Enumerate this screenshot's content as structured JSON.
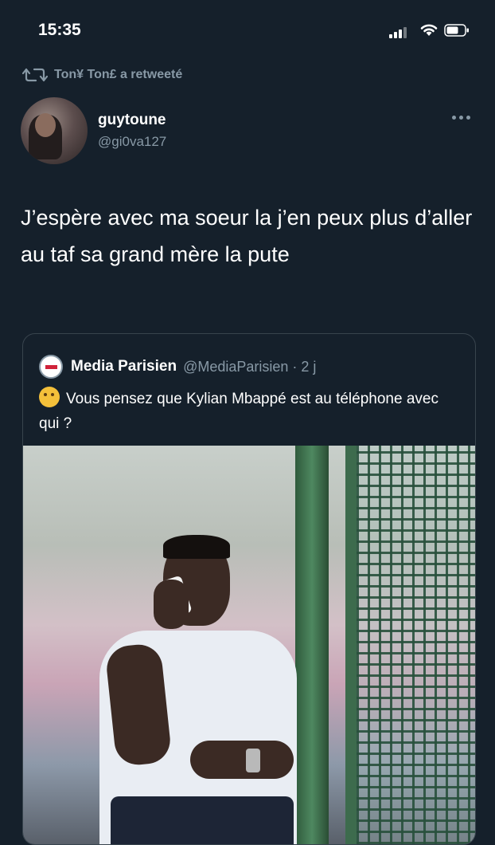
{
  "status_bar": {
    "time": "15:35"
  },
  "retweet": {
    "label": "Ton¥ Ton£ a retweeté"
  },
  "tweet": {
    "display_name": "guytoune",
    "handle": "@gi0va127",
    "text": "J’espère avec ma soeur la j’en peux plus d’aller au taf sa grand mère la pute"
  },
  "quote": {
    "display_name": "Media Parisien",
    "handle_time": "@MediaParisien · 2 j",
    "text": "Vous pensez que Kylian Mbappé est au téléphone avec qui ?",
    "emoji": "thinking-face"
  },
  "colors": {
    "background": "#15202b",
    "secondary_text": "#8899a6",
    "border": "#38444d"
  }
}
